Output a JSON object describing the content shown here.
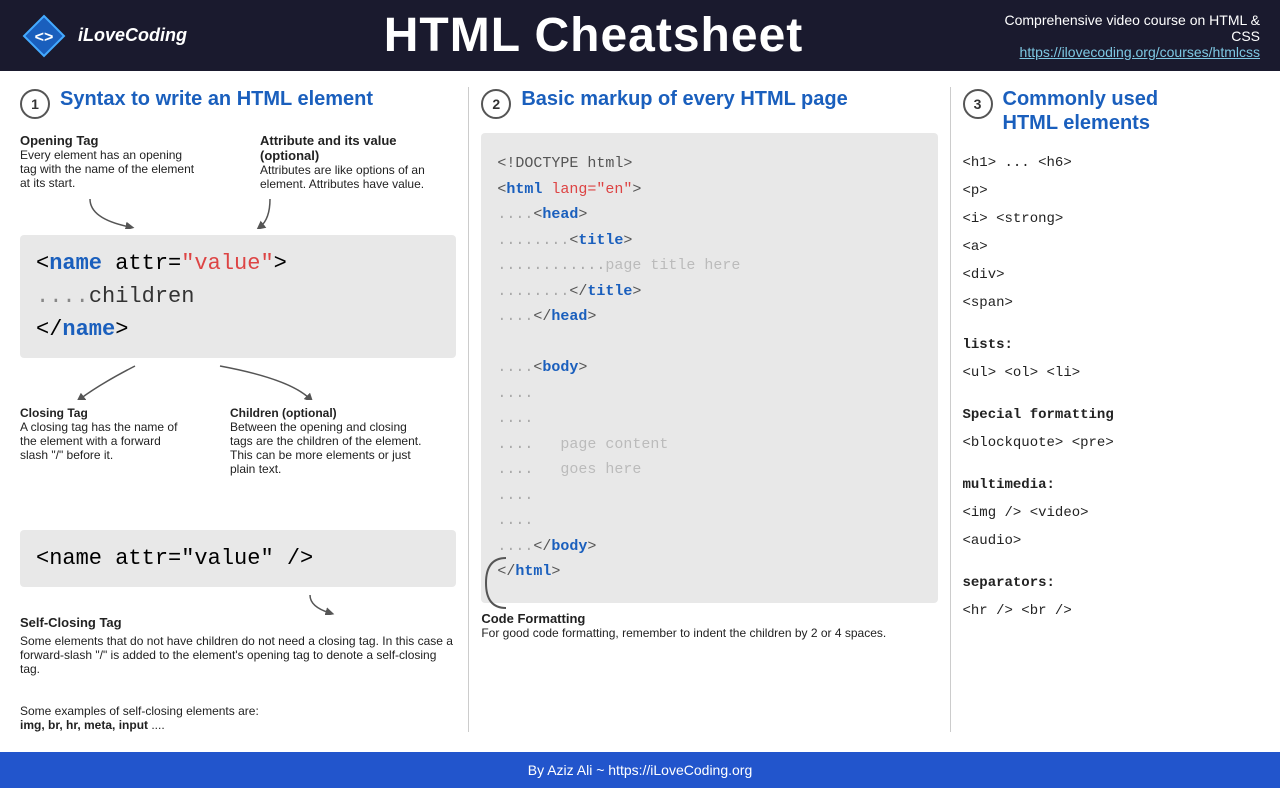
{
  "header": {
    "logo_text": "iLoveCoding",
    "title": "HTML Cheatsheet",
    "course_label": "Comprehensive video course on HTML & CSS",
    "course_link": "https://ilovecoding.org/courses/htmlcss"
  },
  "section1": {
    "num": "1",
    "title": "Syntax to write an HTML element",
    "opening_tag_label": "Opening Tag",
    "opening_tag_desc": "Every element has an opening tag with the name of the element at its start.",
    "attr_label": "Attribute and its value (optional)",
    "attr_desc": "Attributes are like options of an element. Attributes have value.",
    "code1_line1_pre": "< ",
    "code1_line1_name": "name",
    "code1_line1_attr": " attr=",
    "code1_line1_val": "\"value\"",
    "code1_line1_post": ">",
    "code1_line2_dots": "....",
    "code1_line2_text": "children",
    "code1_line3_pre": "</",
    "code1_line3_name": "name",
    "code1_line3_post": ">",
    "closing_tag_label": "Closing Tag",
    "closing_tag_desc": "A closing tag has the name of the element with a forward slash \"/\" before it.",
    "children_label": "Children (optional)",
    "children_desc": "Between the opening and closing tags are the children of the element. This can be more elements or just plain text.",
    "code2_pre": " <",
    "code2_name": "name",
    "code2_attr": " attr=",
    "code2_val": "\"value\"",
    "code2_post": "/>",
    "self_closing_label": "Self-Closing Tag",
    "self_closing_desc": "Some elements that do not have children do not need a closing tag. In this case a forward-slash \"/\" is added to the element's opening tag to denote a self-closing tag.",
    "examples_intro": "Some examples of self-closing elements are:",
    "examples_list": "img, br, hr, meta, input",
    "examples_ellipsis": " ...."
  },
  "section2": {
    "num": "2",
    "title": "Basic markup of every HTML page",
    "code_lines": [
      "<!DOCTYPE html>",
      "<html lang=\"en\">",
      "    <head>",
      "        <title>",
      "            page title here",
      "        </title>",
      "    </head>",
      "",
      "    <body>",
      "    ....",
      "    ....",
      "....  page content",
      "....  goes here",
      "    ....",
      "    ....",
      "    </body>",
      "</html>"
    ],
    "code_format_label": "Code Formatting",
    "code_format_desc": "For good code formatting, remember to indent the children by 2 or 4 spaces."
  },
  "section3": {
    "num": "3",
    "title": "Commonly used\nHTML elements",
    "items": [
      "<h1> ... <h6>",
      "<p>",
      "<i> <strong>",
      "<a>",
      "<div>",
      "<span>"
    ],
    "lists_label": "lists:",
    "lists_items": "<ul>  <ol>  <li>",
    "special_label": "Special formatting",
    "special_items": "<blockquote>  <pre>",
    "multimedia_label": "multimedia:",
    "multimedia_items1": "<img />  <video>",
    "multimedia_items2": "<audio>",
    "separators_label": "separators:",
    "separators_items": "<hr />  <br />"
  },
  "footer": {
    "text": "By Aziz Ali ~ https://iLoveCoding.org"
  }
}
